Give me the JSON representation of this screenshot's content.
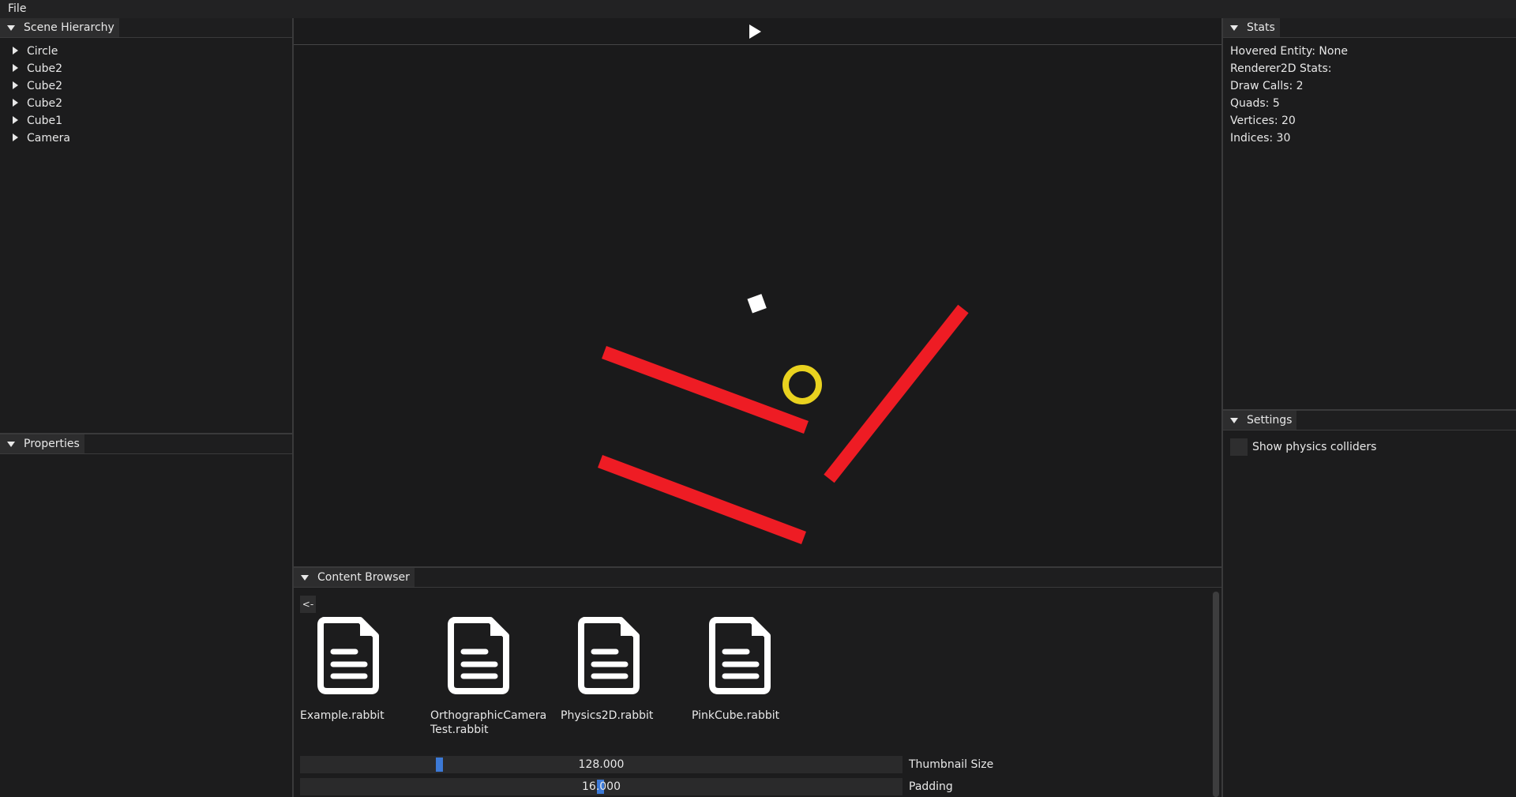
{
  "menu": {
    "file": "File"
  },
  "hierarchy": {
    "title": "Scene Hierarchy",
    "items": [
      {
        "label": "Circle"
      },
      {
        "label": "Cube2"
      },
      {
        "label": "Cube2"
      },
      {
        "label": "Cube2"
      },
      {
        "label": "Cube1"
      },
      {
        "label": "Camera"
      }
    ]
  },
  "properties": {
    "title": "Properties"
  },
  "toolbar": {
    "play_icon": "play-icon"
  },
  "stats": {
    "title": "Stats",
    "lines": [
      "Hovered Entity: None",
      "Renderer2D Stats:",
      "Draw Calls: 2",
      "Quads: 5",
      "Vertices: 20",
      "Indices: 30"
    ]
  },
  "settings": {
    "title": "Settings",
    "show_colliders_label": "Show physics colliders",
    "show_colliders_checked": false
  },
  "content_browser": {
    "title": "Content Browser",
    "back_label": "<-",
    "files": [
      {
        "name": "Example.rabbit",
        "icon": "file-icon"
      },
      {
        "name": "OrthographicCameraTest.rabbit",
        "icon": "file-icon"
      },
      {
        "name": "Physics2D.rabbit",
        "icon": "file-icon"
      },
      {
        "name": "PinkCube.rabbit",
        "icon": "file-icon"
      }
    ],
    "thumbnail_size": {
      "label": "Thumbnail Size",
      "value": "128.000",
      "numeric": 128
    },
    "padding": {
      "label": "Padding",
      "value": "16.000",
      "numeric": 16
    }
  },
  "colors": {
    "platform_red": "#ee1c24",
    "circle_yellow": "#e9d21f",
    "cube_white": "#ffffff",
    "slider_accent": "#3c79d6"
  }
}
